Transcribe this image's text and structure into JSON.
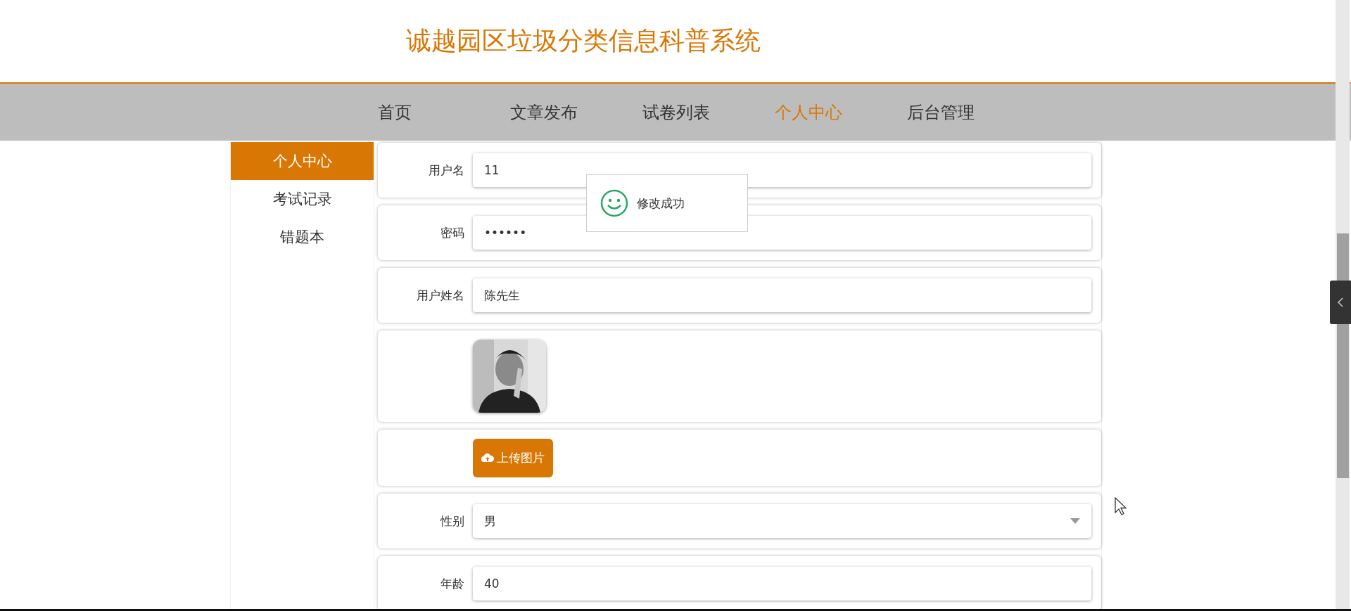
{
  "site_title": "诚越园区垃圾分类信息科普系统",
  "nav": [
    {
      "label": "首页",
      "selected": false
    },
    {
      "label": "文章发布",
      "selected": false
    },
    {
      "label": "试卷列表",
      "selected": false
    },
    {
      "label": "个人中心",
      "selected": true
    },
    {
      "label": "后台管理",
      "selected": false
    }
  ],
  "sidebar": [
    {
      "label": "个人中心",
      "selected": true
    },
    {
      "label": "考试记录",
      "selected": false
    },
    {
      "label": "错题本",
      "selected": false
    }
  ],
  "form": [
    {
      "kind": "text",
      "label": "用户名",
      "value": "11"
    },
    {
      "kind": "password",
      "label": "密码",
      "value": "••••••"
    },
    {
      "kind": "text",
      "label": "用户姓名",
      "value": "陈先生"
    },
    {
      "kind": "avatar"
    },
    {
      "kind": "upload",
      "button": "上传图片"
    },
    {
      "kind": "select",
      "label": "性别",
      "value": "男"
    },
    {
      "kind": "text",
      "label": "年龄",
      "value": "40"
    }
  ],
  "toast": {
    "message": "修改成功"
  }
}
